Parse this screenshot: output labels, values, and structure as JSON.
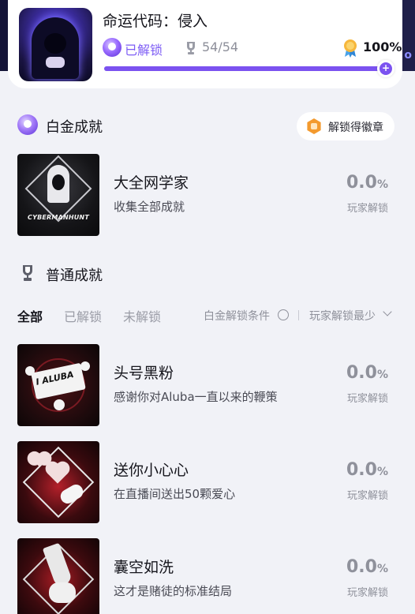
{
  "header": {
    "game_title": "命运代码：侵入",
    "unlocked_label": "已解锁",
    "trophy_count": "54/54",
    "completion_percent": "100%",
    "progress_fraction": 1.0
  },
  "platinum_section": {
    "title": "白金成就",
    "badge_button_label": "解锁得徽章",
    "achievement": {
      "name": "大全网学家",
      "description": "收集全部成就",
      "rate_value": "0.0",
      "rate_unit": "%",
      "rate_label": "玩家解锁",
      "art_text": "CYBERMANHUNT"
    }
  },
  "normal_section": {
    "title": "普通成就",
    "tabs": [
      "全部",
      "已解锁",
      "未解锁"
    ],
    "active_tab": "全部",
    "condition_label": "白金解锁条件",
    "sort_label": "玩家解锁最少",
    "achievements": [
      {
        "name": "头号黑粉",
        "description": "感谢你对Aluba一直以来的鞭策",
        "rate_value": "0.0",
        "rate_unit": "%",
        "rate_label": "玩家解锁",
        "art_text": "I ALUBA"
      },
      {
        "name": "送你小心心",
        "description": "在直播间送出50颗爱心",
        "rate_value": "0.0",
        "rate_unit": "%",
        "rate_label": "玩家解锁"
      },
      {
        "name": "囊空如洗",
        "description": "这才是赌徒的标准结局",
        "rate_value": "0.0",
        "rate_unit": "%",
        "rate_label": "玩家解锁"
      }
    ]
  },
  "colors": {
    "accent_purple": "#7b52f0",
    "muted_gray": "#8f919b",
    "background": "#f1f2f7"
  },
  "icons": [
    "platinum-trophy-icon",
    "trophy-icon",
    "medal-icon",
    "badge-icon",
    "chevron-down-icon"
  ]
}
